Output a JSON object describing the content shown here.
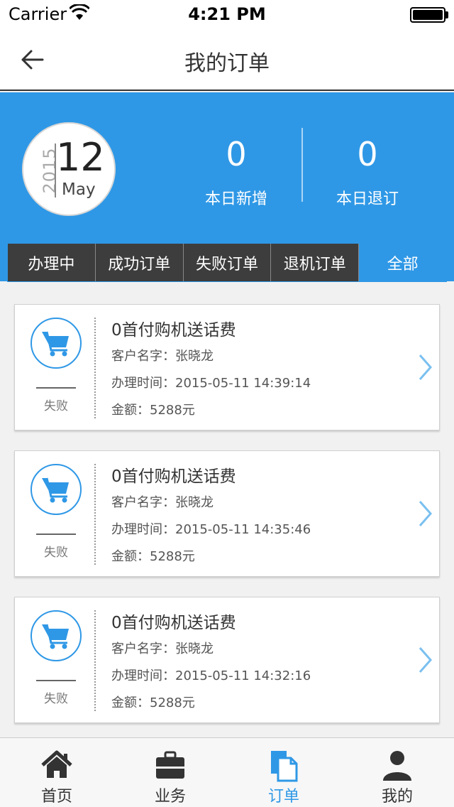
{
  "status_bar": {
    "carrier": "Carrier",
    "time": "4:21 PM"
  },
  "nav": {
    "title": "我的订单"
  },
  "header": {
    "date": {
      "year": "2015",
      "day": "12",
      "month": "May"
    },
    "new_today": {
      "value": "0",
      "label": "本日新增"
    },
    "cancel_today": {
      "value": "0",
      "label": "本日退订"
    }
  },
  "tabs": [
    {
      "label": "办理中",
      "active": false
    },
    {
      "label": "成功订单",
      "active": false
    },
    {
      "label": "失败订单",
      "active": false
    },
    {
      "label": "退机订单",
      "active": false
    },
    {
      "label": "全部",
      "active": true
    }
  ],
  "orders": [
    {
      "name": "0首付购机送话费",
      "customer": "客户名字：张晓龙",
      "time": "办理时间：2015-05-11 14:39:14",
      "amount": "金额：5288元",
      "status": "失败"
    },
    {
      "name": "0首付购机送话费",
      "customer": "客户名字：张晓龙",
      "time": "办理时间：2015-05-11 14:35:46",
      "amount": "金额：5288元",
      "status": "失败"
    },
    {
      "name": "0首付购机送话费",
      "customer": "客户名字：张晓龙",
      "time": "办理时间：2015-05-11 14:32:16",
      "amount": "金额：5288元",
      "status": "失败"
    }
  ],
  "tab_bar": [
    {
      "label": "首页",
      "icon": "home-icon",
      "active": false
    },
    {
      "label": "业务",
      "icon": "briefcase-icon",
      "active": false
    },
    {
      "label": "订单",
      "icon": "document-icon",
      "active": true
    },
    {
      "label": "我的",
      "icon": "user-icon",
      "active": false
    }
  ],
  "colors": {
    "accent": "#2f98e6",
    "tab_dark": "#3d3d3d"
  }
}
